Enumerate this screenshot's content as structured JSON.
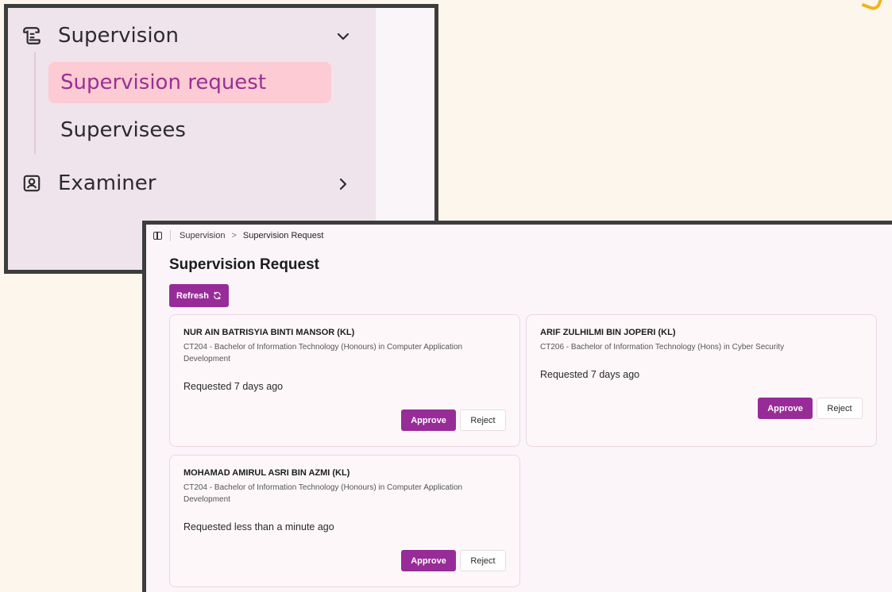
{
  "sidebar": {
    "items": [
      {
        "label": "Supervision",
        "icon": "scroll-icon",
        "expanded": true,
        "children": [
          {
            "label": "Supervision request",
            "active": true
          },
          {
            "label": "Supervisees",
            "active": false
          }
        ]
      },
      {
        "label": "Examiner",
        "icon": "user-card-icon",
        "expanded": false
      }
    ]
  },
  "breadcrumb": {
    "items": [
      "Supervision",
      "Supervision Request"
    ],
    "separator": ">"
  },
  "page": {
    "title": "Supervision Request",
    "refresh_label": "Refresh"
  },
  "requests": [
    {
      "name": "NUR AIN BATRISYIA BINTI MANSOR (KL)",
      "program": "CT204 - Bachelor of Information Technology (Honours) in Computer Application Development",
      "requested": "Requested 7 days ago",
      "approve_label": "Approve",
      "reject_label": "Reject"
    },
    {
      "name": "ARIF ZULHILMI BIN JOPERI (KL)",
      "program": "CT206 - Bachelor of Information Technology (Hons) in Cyber Security",
      "requested": "Requested 7 days ago",
      "approve_label": "Approve",
      "reject_label": "Reject"
    },
    {
      "name": "MOHAMAD AMIRUL ASRI BIN AZMI (KL)",
      "program": "CT204 - Bachelor of Information Technology (Honours) in Computer Application Development",
      "requested": "Requested less than a minute ago",
      "approve_label": "Approve",
      "reject_label": "Reject"
    }
  ],
  "colors": {
    "primary": "#972c98",
    "active_item_bg": "#fccbd3",
    "active_item_text": "#9c2f92",
    "page_bg": "#fdf6ec"
  }
}
